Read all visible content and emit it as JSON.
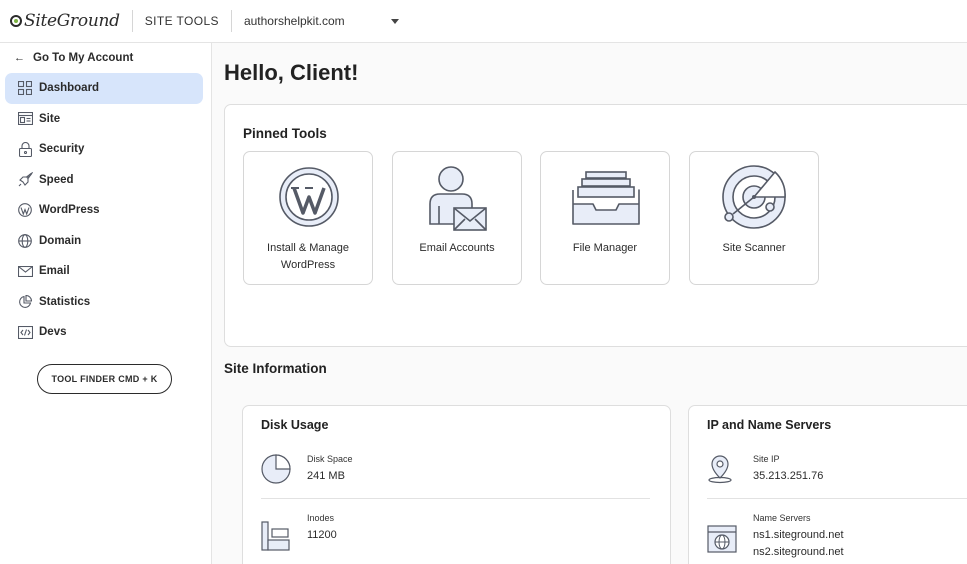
{
  "header": {
    "logo_text": "SiteGround",
    "site_tools": "SITE TOOLS",
    "domain": "authorshelpkit.com"
  },
  "sidebar": {
    "back_label": "Go To My Account",
    "items": [
      {
        "label": "Dashboard",
        "icon": "grid-icon",
        "active": true
      },
      {
        "label": "Site",
        "icon": "browser-icon"
      },
      {
        "label": "Security",
        "icon": "lock-icon"
      },
      {
        "label": "Speed",
        "icon": "rocket-icon"
      },
      {
        "label": "WordPress",
        "icon": "wordpress-icon"
      },
      {
        "label": "Domain",
        "icon": "globe-icon"
      },
      {
        "label": "Email",
        "icon": "envelope-icon"
      },
      {
        "label": "Statistics",
        "icon": "pie-chart-icon"
      },
      {
        "label": "Devs",
        "icon": "code-icon"
      }
    ],
    "tool_finder": "TOOL FINDER CMD + K"
  },
  "main": {
    "greeting": "Hello, Client!",
    "pinned": {
      "title": "Pinned Tools",
      "tools": [
        {
          "label": "Install & Manage WordPress",
          "icon": "wordpress-icon"
        },
        {
          "label": "Email Accounts",
          "icon": "user-mail-icon"
        },
        {
          "label": "File Manager",
          "icon": "file-tray-icon"
        },
        {
          "label": "Site Scanner",
          "icon": "radar-icon"
        }
      ]
    },
    "site_info": {
      "title": "Site Information",
      "disk": {
        "title": "Disk Usage",
        "disk_space_label": "Disk Space",
        "disk_space_value": "241 MB",
        "inodes_label": "Inodes",
        "inodes_value": "11200"
      },
      "ip": {
        "title": "IP and Name Servers",
        "site_ip_label": "Site IP",
        "site_ip_value": "35.213.251.76",
        "ns_label": "Name Servers",
        "ns1": "ns1.siteground.net",
        "ns2": "ns2.siteground.net"
      }
    }
  },
  "colors": {
    "active_nav": "#d7e5fb",
    "icon_fill": "#e8edf8",
    "icon_stroke": "#555a66"
  }
}
